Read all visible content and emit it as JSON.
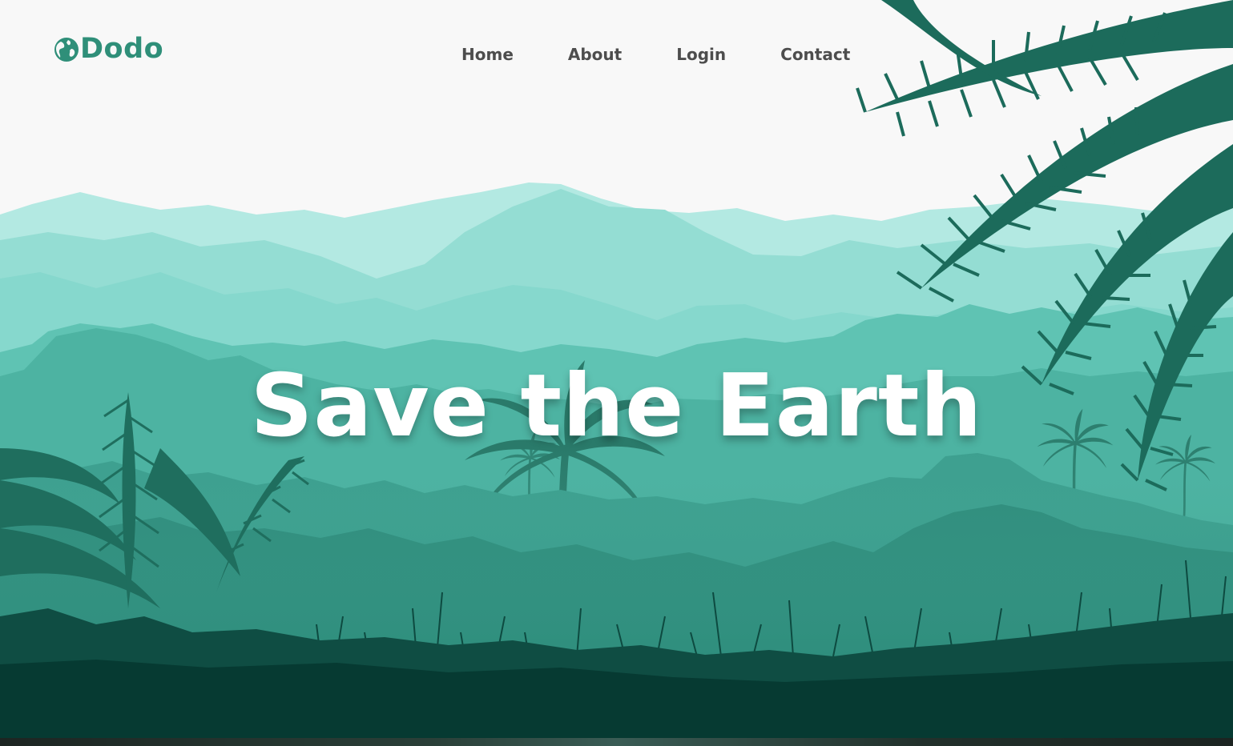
{
  "brand": {
    "name": "Dodo",
    "icon": "globe-icon",
    "color": "#2f8f79"
  },
  "nav": {
    "items": [
      "Home",
      "About",
      "Login",
      "Contact"
    ]
  },
  "hero": {
    "title": "Save the Earth"
  },
  "palette": {
    "sky": "#f8f8f8",
    "mountain_light": "#b2e8e1",
    "mountain_mid": "#8edcd2",
    "jungle": "#4ab6a4",
    "forest_dark": "#1f6b5b",
    "ground": "#063a32"
  }
}
